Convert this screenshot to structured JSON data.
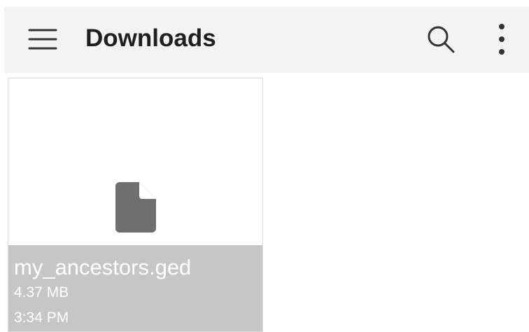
{
  "toolbar": {
    "title": "Downloads",
    "icons": {
      "menu": "hamburger-menu-icon",
      "search": "search-icon",
      "more": "more-vertical-icon"
    }
  },
  "files": [
    {
      "name": "my_ancestors.ged",
      "size": "4.37 MB",
      "time": "3:34 PM",
      "icon": "document-icon"
    }
  ],
  "colors": {
    "toolbar_background": "#f3f3f3",
    "title_text": "#1f1f1f",
    "card_info_background": "#c6c6c6",
    "file_icon": "#6f6f6f"
  }
}
